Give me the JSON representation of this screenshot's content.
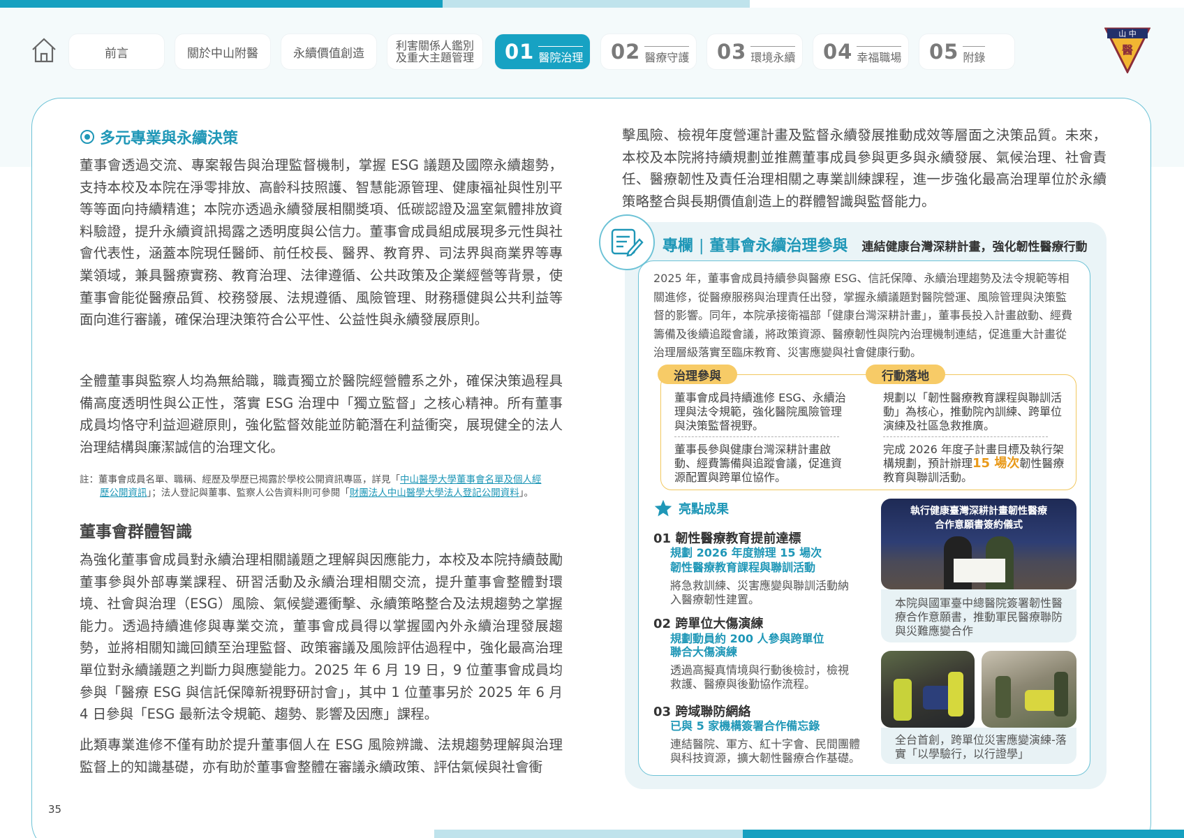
{
  "nav": {
    "tabs": [
      {
        "label": "前言"
      },
      {
        "label": "關於中山附醫"
      },
      {
        "label": "永續價值創造"
      },
      {
        "label_line1": "利害關係人鑑別",
        "label_line2": "及重大主題管理"
      }
    ],
    "chapters": [
      {
        "num": "01",
        "label": "醫院治理",
        "active": true
      },
      {
        "num": "02",
        "label": "醫療守護"
      },
      {
        "num": "03",
        "label": "環境永續"
      },
      {
        "num": "04",
        "label": "幸福職場"
      },
      {
        "num": "05",
        "label": "附錄"
      }
    ],
    "logo_text": "山中醫"
  },
  "left": {
    "section_title": "多元專業與永續決策",
    "para1": "董事會透過交流、專案報告與治理監督機制，掌握 ESG 議題及國際永續趨勢，支持本校及本院在淨零排放、高齡科技照護、智慧能源管理、健康福祉與性別平等等面向持續精進；本院亦透過永續發展相關獎項、低碳認證及溫室氣體排放資料驗證，提升永續資訊揭露之透明度與公信力。董事會成員組成展現多元性與社會代表性，涵蓋本院現任醫師、前任校長、醫界、教育界、司法界與商業界等專業領域，兼具醫療實務、教育治理、法律遵循、公共政策及企業經營等背景，使董事會能從醫療品質、校務發展、法規遵循、風險管理、財務穩健與公共利益等面向進行審議，確保治理決策符合公平性、公益性與永續發展原則。",
    "para2": "全體董事與監察人均為無給職，職責獨立於醫院經營體系之外，確保決策過程具備高度透明性與公正性，落實 ESG 治理中「獨立監督」之核心精神。所有董事成員均恪守利益迴避原則，強化監督效能並防範潛在利益衝突，展現健全的法人治理結構與廉潔誠信的治理文化。",
    "note": {
      "prefix": "註：董事會成員名單、職稱、經歷及學歷已揭露於學校公開資訊專區，詳見「",
      "link1_a": "中山醫學大學董事會名單及個人經",
      "link1_b": "歷公開資訊",
      "middle": "」；法人登記與董事、監察人公告資料則可參閱「",
      "link2": "財團法人中山醫學大學法人登記公開資料",
      "suffix": "」。"
    },
    "h2": "董事會群體智識",
    "para3": "為強化董事會成員對永續治理相關議題之理解與因應能力，本校及本院持續鼓勵董事參與外部專業課程、研習活動及永續治理相關交流，提升董事會整體對環境、社會與治理（ESG）風險、氣候變遷衝擊、永續策略整合及法規趨勢之掌握能力。透過持續進修與專業交流，董事會成員得以掌握國內外永續治理發展趨勢，並將相關知識回饋至治理監督、政策審議及風險評估過程中，強化最高治理單位對永續議題之判斷力與應變能力。2025 年 6 月 19 日，9 位董事會成員均參與「醫療 ESG 與信託保障新視野研討會」，其中 1 位董事另於 2025 年 6 月 4 日參與「ESG 最新法令規範、趨勢、影響及因應」課程。",
    "para4": "此類專業進修不僅有助於提升董事個人在 ESG 風險辨識、法規趨勢理解與治理監督上的知識基礎，亦有助於董事會整體在審議永續政策、評估氣候與社會衝"
  },
  "right": {
    "para_cont": "擊風險、檢視年度營運計畫及監督永續發展推動成效等層面之決策品質。未來，本校及本院將持續規劃並推薦董事成員參與更多與永續發展、氣候治理、社會責任、醫療韌性及責任治理相關之專業訓練課程，進一步強化最高治理單位於永續策略整合與長期價值創造上的群體智識與監督能力。",
    "column": {
      "label": "專欄",
      "title": "董事會永續治理參與",
      "subtitle": "連結健康台灣深耕計畫，強化韌性醫療行動",
      "intro": "2025 年，董事會成員持續參與醫療 ESG、信託保障、永續治理趨勢及法令規範等相關進修，從醫療服務與治理責任出發，掌握永續議題對醫院營運、風險管理與決策監督的影響。同年，本院承接衛福部「健康台灣深耕計畫」，董事長投入計畫啟動、經費籌備及後續追蹤會議，將政策資源、醫療韌性與院內治理機制連結，促進重大計畫從治理層級落實至臨床教育、災害應變與社會健康行動。",
      "gov_pill": "治理參與",
      "act_pill": "行動落地",
      "gov1": "董事會成員持續進修 ESG、永續治理與法令規範，強化醫院風險管理與決策監督視野。",
      "gov2": "董事長參與健康台灣深耕計畫啟動、經費籌備與追蹤會議，促進資源配置與跨單位協作。",
      "act1": "規劃以「韌性醫療教育課程與聯訓活動」為核心，推動院內訓練、跨單位演練及社區急救推廣。",
      "act2_pre": "完成 2026 年度子計畫目標及執行架構規劃，預計辦理",
      "act2_hl": "15 場次",
      "act2_post": "韌性醫療教育與聯訓活動。",
      "highlights_title": "亮點成果",
      "items": [
        {
          "head": "01 韌性醫療教育提前達標",
          "bold1": "規劃 2026 年度辦理 15 場次",
          "bold2": "韌性醫療教育課程與聯訓活動",
          "text1": "將急救訓練、災害應變與聯訓活動納",
          "text2": "入醫療韌性建置。"
        },
        {
          "head": "02 跨單位大傷演練",
          "bold1": "規劃動員約 200 人參與跨單位",
          "bold2": "聯合大傷演練",
          "text1": "透過高擬真情境與行動後檢討，檢視",
          "text2": "救護、醫療與後勤協作流程。"
        },
        {
          "head": "03 跨域聯防網絡",
          "bold1": "已與 5 家機構簽署合作備忘錄",
          "bold2": "",
          "text1": "連結醫院、軍方、紅十字會、民間團體",
          "text2": "與科技資源，擴大韌性醫療合作基礎。"
        }
      ],
      "photo1_banner1": "執行健康臺灣深耕計畫韌性醫療",
      "photo1_banner2": "合作意願書簽約儀式",
      "photo1_caption1": "本院與國軍臺中總醫院簽署韌性醫",
      "photo1_caption2": "療合作意願書，推動軍民醫療聯防",
      "photo1_caption3": "與災難應變合作",
      "photo2_caption1": "全台首創，跨單位災害應變演練-落",
      "photo2_caption2": "實「以學驗行，以行證學」"
    }
  },
  "page_number": "35",
  "colors": {
    "primary": "#17a2c3",
    "accent_yellow": "#f7cb67",
    "highlight_orange": "#e99a1b"
  }
}
